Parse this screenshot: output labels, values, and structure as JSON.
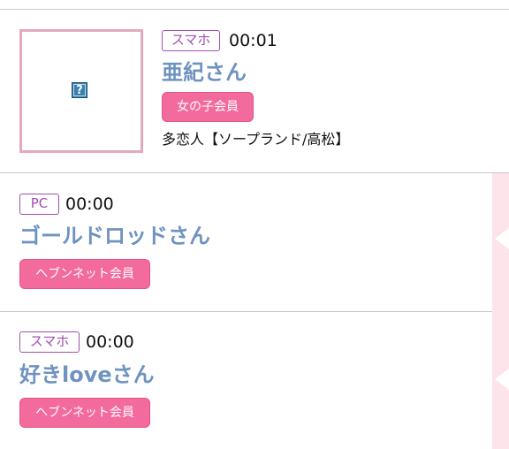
{
  "entries": [
    {
      "device": "スマホ",
      "time": "00:01",
      "name": "亜紀さん",
      "member_type": "女の子会員",
      "shop": "多恋人【ソープランド/高松】",
      "thumbnail_icon": "broken-image-icon"
    },
    {
      "device": "PC",
      "time": "00:00",
      "name": "ゴールドロッドさん",
      "member_type": "ヘブンネット会員"
    },
    {
      "device": "スマホ",
      "time": "00:00",
      "name": "好きloveさん",
      "member_type": "ヘブンネット会員"
    }
  ],
  "colors": {
    "device_badge": "#a34fb0",
    "name": "#6f93c0",
    "member_badge": "#f36a9c",
    "thumbnail_border": "#e4a9bb",
    "side_strip": "#fde4ea"
  }
}
